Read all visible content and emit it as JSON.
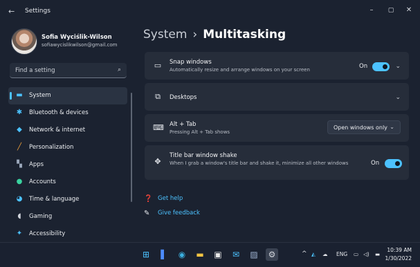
{
  "window": {
    "title": "Settings",
    "back_glyph": "←",
    "minimize_glyph": "–",
    "maximize_glyph": "▢",
    "close_glyph": "✕"
  },
  "profile": {
    "name": "Sofia Wyciślik-Wilson",
    "email": "sofiawycislikwilson@gmail.com"
  },
  "search": {
    "placeholder": "Find a setting",
    "icon": "search-icon"
  },
  "sidebar": {
    "items": [
      {
        "label": "System",
        "icon": "monitor-icon",
        "glyph": "▬",
        "color": "#4cc2ff",
        "selected": true
      },
      {
        "label": "Bluetooth & devices",
        "icon": "bluetooth-icon",
        "glyph": "✱",
        "color": "#4cc2ff"
      },
      {
        "label": "Network & internet",
        "icon": "wifi-icon",
        "glyph": "◆",
        "color": "#4cc2ff"
      },
      {
        "label": "Personalization",
        "icon": "brush-icon",
        "glyph": "╱",
        "color": "#f2a23a"
      },
      {
        "label": "Apps",
        "icon": "apps-icon",
        "glyph": "▚",
        "color": "#9aa7ba"
      },
      {
        "label": "Accounts",
        "icon": "person-icon",
        "glyph": "●",
        "color": "#3ad29f"
      },
      {
        "label": "Time & language",
        "icon": "globe-icon",
        "glyph": "◕",
        "color": "#4cc2ff"
      },
      {
        "label": "Gaming",
        "icon": "controller-icon",
        "glyph": "◖",
        "color": "#cfd3da"
      },
      {
        "label": "Accessibility",
        "icon": "accessibility-icon",
        "glyph": "✦",
        "color": "#4cc2ff"
      }
    ]
  },
  "main": {
    "breadcrumb_parent": "System",
    "breadcrumb_separator": "›",
    "breadcrumb_current": "Multitasking",
    "cards": {
      "snap": {
        "title": "Snap windows",
        "desc": "Automatically resize and arrange windows on your screen",
        "toggle_label": "On",
        "toggle_on": true,
        "icon_glyph": "▭",
        "chevron": "⌄"
      },
      "desktops": {
        "title": "Desktops",
        "icon_glyph": "⧉",
        "chevron": "⌄"
      },
      "alttab": {
        "title": "Alt + Tab",
        "desc": "Pressing Alt + Tab shows",
        "dropdown_value": "Open windows only",
        "icon_glyph": "⌨",
        "chevron": "⌄"
      },
      "shake": {
        "title": "Title bar window shake",
        "desc": "When I grab a window's title bar and shake it, minimize all other windows",
        "toggle_label": "On",
        "toggle_on": true,
        "icon_glyph": "✥"
      }
    },
    "links": {
      "help": "Get help",
      "feedback": "Give feedback"
    }
  },
  "taskbar": {
    "apps": [
      {
        "name": "start-icon",
        "glyph": "⊞",
        "color": "#4cc2ff"
      },
      {
        "name": "widgets-icon",
        "glyph": "▌",
        "color": "#4c8cff"
      },
      {
        "name": "edge-icon",
        "glyph": "◉",
        "color": "#3bb0e0"
      },
      {
        "name": "file-explorer-icon",
        "glyph": "▬",
        "color": "#f2c443"
      },
      {
        "name": "store-icon",
        "glyph": "▣",
        "color": "#e8e8e8"
      },
      {
        "name": "mail-icon",
        "glyph": "✉",
        "color": "#4cc2ff"
      },
      {
        "name": "photos-icon",
        "glyph": "▨",
        "color": "#9fb3d1"
      },
      {
        "name": "settings-icon",
        "glyph": "⚙",
        "color": "#cfd3da",
        "active": true
      }
    ],
    "tray": {
      "chevron": "^",
      "language": "ENG",
      "time": "10:39 AM",
      "date": "1/30/2022"
    }
  }
}
